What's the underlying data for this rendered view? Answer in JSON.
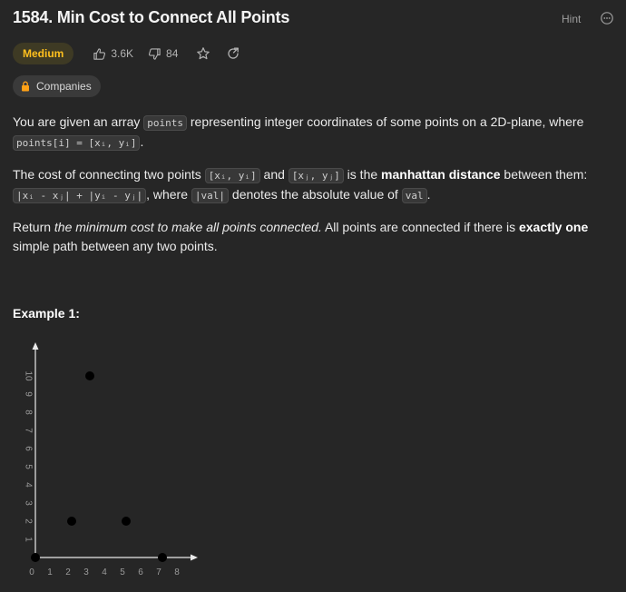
{
  "problem": {
    "title": "1584. Min Cost to Connect All Points",
    "hint_label": "Hint",
    "difficulty": "Medium",
    "likes": "3.6K",
    "dislikes": "84",
    "companies_label": "Companies"
  },
  "description": {
    "p1": {
      "t1": "You are given an array ",
      "c1": "points",
      "t2": " representing integer coordinates of some points on a 2D-plane, where ",
      "c2": "points[i] = [xᵢ, yᵢ]",
      "t3": "."
    },
    "p2": {
      "t1": "The cost of connecting two points ",
      "c1": "[xᵢ, yᵢ]",
      "t2": " and ",
      "c2": "[xⱼ, yⱼ]",
      "t3": " is the ",
      "b1": "manhattan distance",
      "t4": " between them: ",
      "c3": "|xᵢ - xⱼ| + |yᵢ - yⱼ|",
      "t5": ", where ",
      "c4": "|val|",
      "t6": " denotes the absolute value of ",
      "c5": "val",
      "t7": "."
    },
    "p3": {
      "t1": "Return ",
      "i1": "the minimum cost to make all points connected.",
      "t2": " All points are connected if there is ",
      "b1": "exactly one",
      "t3": " simple path between any two points."
    }
  },
  "example": {
    "title": "Example 1:"
  },
  "chart_data": {
    "type": "scatter",
    "x_ticks": [
      "0",
      "1",
      "2",
      "3",
      "4",
      "5",
      "6",
      "7",
      "8"
    ],
    "y_ticks": [
      "1",
      "2",
      "3",
      "4",
      "5",
      "6",
      "7",
      "8",
      "9",
      "10"
    ],
    "xlim": [
      0,
      8
    ],
    "ylim": [
      0,
      10
    ],
    "points": [
      {
        "x": 0,
        "y": 0
      },
      {
        "x": 2,
        "y": 2
      },
      {
        "x": 3,
        "y": 10
      },
      {
        "x": 5,
        "y": 2
      },
      {
        "x": 7,
        "y": 0
      }
    ],
    "colors": {
      "axis": "#eaeaea",
      "tick": "#9a9a9a",
      "point": "#000000"
    }
  },
  "colors": {
    "background": "#262626",
    "medium": "#ffc01e",
    "badge_bg": "#3e3a24"
  }
}
